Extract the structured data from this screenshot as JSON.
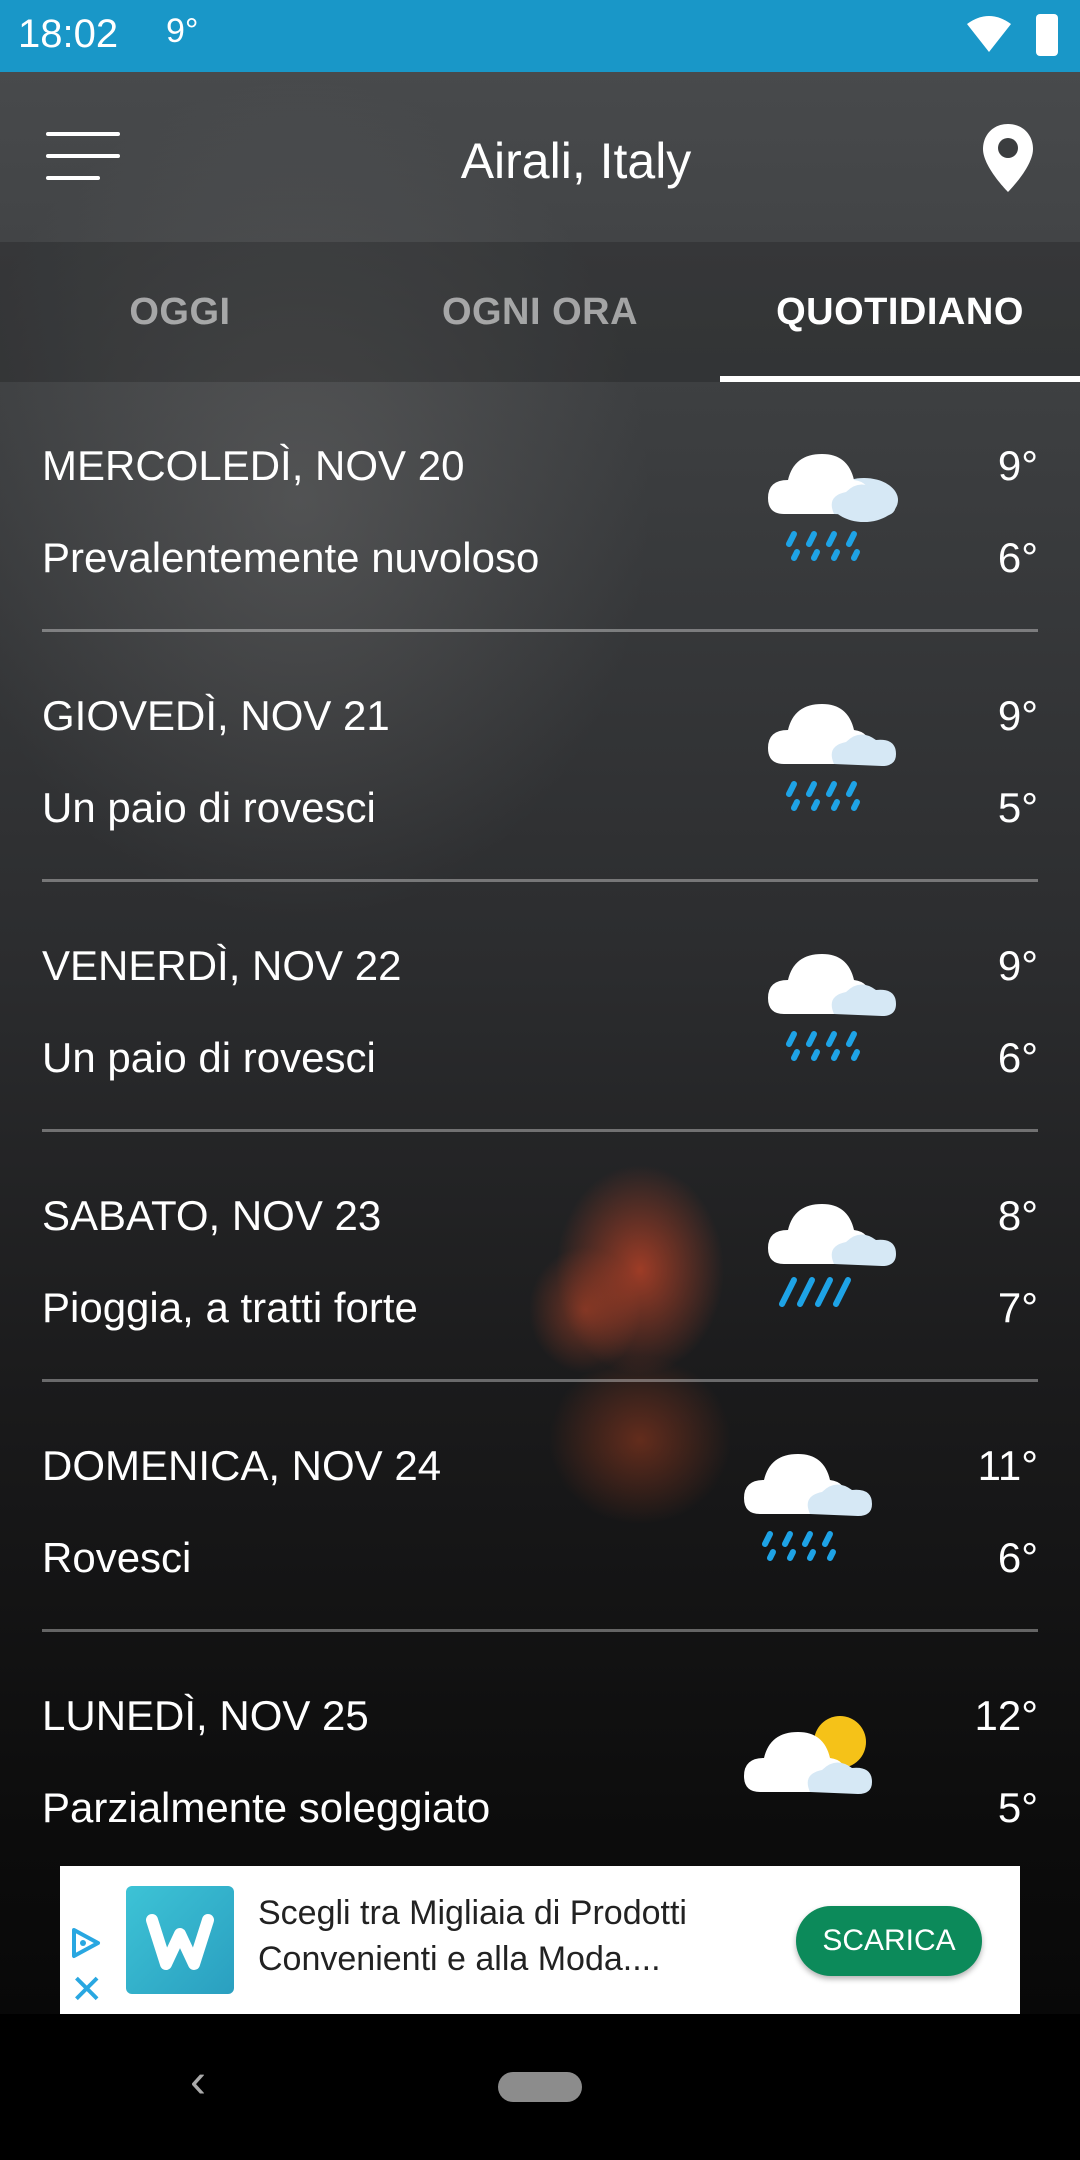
{
  "status_bar": {
    "time": "18:02",
    "temperature": "9°",
    "color": "#1997c8"
  },
  "app_bar": {
    "title": "Airali, Italy",
    "menu_icon": "hamburger-menu-icon",
    "location_icon": "map-pin-icon"
  },
  "tabs": [
    {
      "label": "OGGI",
      "active": false
    },
    {
      "label": "OGNI ORA",
      "active": false
    },
    {
      "label": "QUOTIDIANO",
      "active": true
    }
  ],
  "forecast": [
    {
      "date": "MERCOLEDÌ, NOV 20",
      "description": "Prevalentemente nuvoloso",
      "high": "9°",
      "low": "6°",
      "icon": "rain-cloud-icon"
    },
    {
      "date": "GIOVEDÌ, NOV 21",
      "description": "Un paio di rovesci",
      "high": "9°",
      "low": "5°",
      "icon": "rain-cloud-icon"
    },
    {
      "date": "VENERDÌ, NOV 22",
      "description": "Un paio di rovesci",
      "high": "9°",
      "low": "6°",
      "icon": "rain-cloud-icon"
    },
    {
      "date": "SABATO, NOV 23",
      "description": "Pioggia, a tratti forte",
      "high": "8°",
      "low": "7°",
      "icon": "heavy-rain-cloud-icon"
    },
    {
      "date": "DOMENICA, NOV 24",
      "description": "Rovesci",
      "high": "11°",
      "low": "6°",
      "icon": "rain-cloud-icon"
    },
    {
      "date": "LUNEDÌ, NOV 25",
      "description": "Parzialmente soleggiato",
      "high": "12°",
      "low": "5°",
      "icon": "partly-sunny-icon"
    }
  ],
  "ad": {
    "text": "Scegli tra Migliaia di Prodotti Convenienti e alla Moda....",
    "button_label": "SCARICA",
    "button_color": "#0c8a5a",
    "logo_letter": "w"
  },
  "colors": {
    "rain_drop": "#1ea3e6",
    "sun": "#f5c218",
    "cloud": "#ffffff",
    "cloud_back": "#d6e8f5"
  }
}
